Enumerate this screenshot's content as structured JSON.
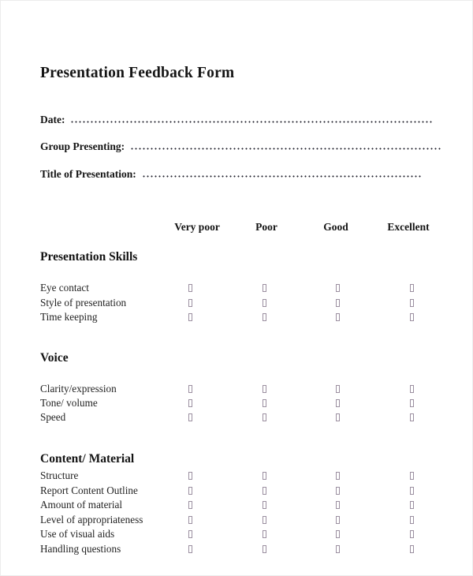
{
  "document": {
    "title": "Presentation Feedback Form"
  },
  "fields": [
    {
      "label": "Date:",
      "value": "",
      "dots_width": 460
    },
    {
      "label": "Group Presenting:",
      "value": "",
      "dots_width": 395
    },
    {
      "label": "Title of Presentation:",
      "value": "",
      "dots_width": 355
    }
  ],
  "rating_scale": [
    "Very poor",
    "Poor",
    "Good",
    "Excellent"
  ],
  "sections": [
    {
      "heading": "Presentation Skills",
      "criteria": [
        "Eye contact",
        "Style of presentation",
        "Time keeping"
      ]
    },
    {
      "heading": "Voice",
      "criteria": [
        "Clarity/expression",
        "Tone/ volume",
        "Speed"
      ]
    },
    {
      "heading": "Content/ Material",
      "criteria": [
        "Structure",
        "Report Content Outline",
        "Amount of material",
        "Level of appropriateness",
        "Use of visual aids",
        "Handling questions"
      ]
    }
  ],
  "colors": {
    "text": "#1a1a1a",
    "heading": "#131313",
    "checkbox_outline": "#9b8fa0",
    "page_border": "#ececec",
    "background": "#ffffff"
  }
}
